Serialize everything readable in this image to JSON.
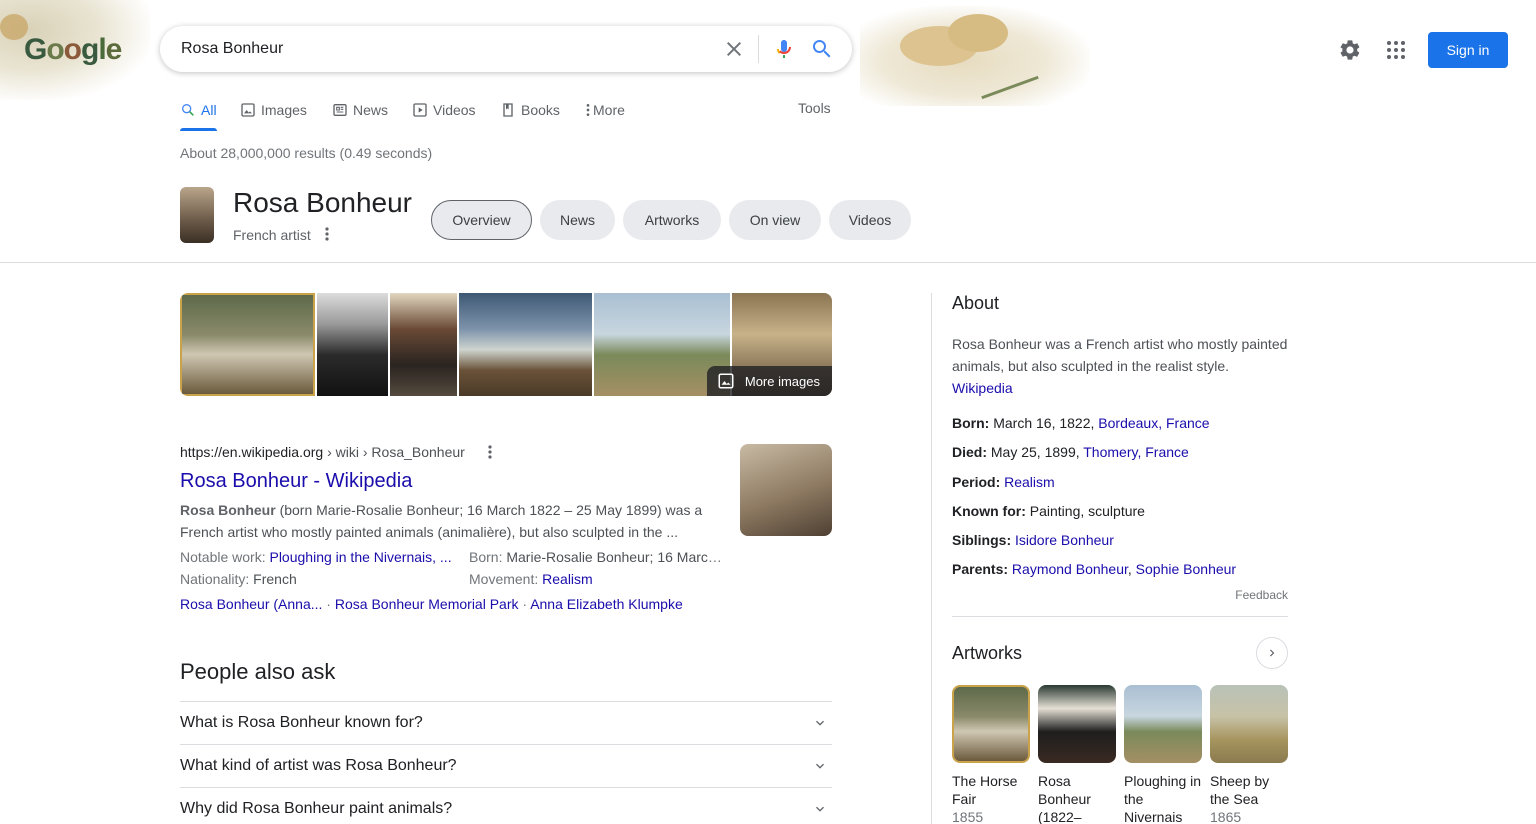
{
  "header": {
    "query": "Rosa Bonheur",
    "sign_in": "Sign in"
  },
  "tabs": [
    {
      "label": "All",
      "icon": "search-icon",
      "active": true
    },
    {
      "label": "Images",
      "icon": "image-icon"
    },
    {
      "label": "News",
      "icon": "newspaper-icon"
    },
    {
      "label": "Videos",
      "icon": "play-icon"
    },
    {
      "label": "Books",
      "icon": "book-icon"
    },
    {
      "label": "More",
      "icon": "more-vert-icon"
    }
  ],
  "tools_label": "Tools",
  "stats": "About 28,000,000 results (0.49 seconds)",
  "entity": {
    "title": "Rosa Bonheur",
    "subtitle": "French artist",
    "chips": [
      "Overview",
      "News",
      "Artworks",
      "On view",
      "Videos"
    ]
  },
  "images": {
    "more_label": "More images"
  },
  "result": {
    "domain": "https://en.wikipedia.org",
    "path": " › wiki › Rosa_Bonheur",
    "title": "Rosa Bonheur - Wikipedia",
    "snippet_bold": "Rosa Bonheur",
    "snippet": " (born Marie-Rosalie Bonheur; 16 March 1822 – 25 May 1899) was a French artist who mostly painted animals (animalière), but also sculpted in the ...",
    "facts": {
      "notable_label": "Notable work: ",
      "notable_value": "Ploughing in the Nivernais, ...",
      "born_label": "Born: ",
      "born_value": "Marie-Rosalie Bonheur; 16 March ...",
      "nationality_label": "Nationality: ",
      "nationality_value": "French",
      "movement_label": "Movement: ",
      "movement_value": "Realism"
    },
    "sitelinks": [
      "Rosa Bonheur (Anna...",
      "Rosa Bonheur Memorial Park",
      "Anna Elizabeth Klumpke"
    ],
    "sitelink_sep": " · "
  },
  "paa": {
    "title": "People also ask",
    "questions": [
      "What is Rosa Bonheur known for?",
      "What kind of artist was Rosa Bonheur?",
      "Why did Rosa Bonheur paint animals?"
    ]
  },
  "kp": {
    "about_heading": "About",
    "description": "Rosa Bonheur was a French artist who mostly painted animals, but also sculpted in the realist style.",
    "wiki_link": "Wikipedia",
    "born_label": "Born:",
    "born_text": " March 16, 1822, ",
    "born_link": "Bordeaux, France",
    "died_label": "Died:",
    "died_text": " May 25, 1899, ",
    "died_link": "Thomery, France",
    "period_label": "Period:",
    "period_link": "Realism",
    "known_label": "Known for:",
    "known_text": " Painting, sculpture",
    "siblings_label": "Siblings:",
    "siblings_link": "Isidore Bonheur",
    "parents_label": "Parents:",
    "parents_link1": "Raymond Bonheur",
    "parents_sep": ", ",
    "parents_link2": "Sophie Bonheur",
    "feedback": "Feedback",
    "artworks_heading": "Artworks",
    "artworks": [
      {
        "name": "The Horse Fair",
        "year": "1855"
      },
      {
        "name": "Rosa Bonheur (1822–",
        "year": ""
      },
      {
        "name": "Ploughing in the Nivernais",
        "year": ""
      },
      {
        "name": "Sheep by the Sea",
        "year": "1865"
      }
    ]
  }
}
